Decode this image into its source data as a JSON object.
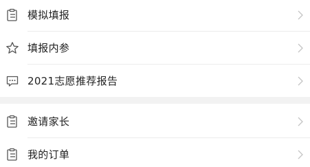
{
  "group1": [
    {
      "label": "模拟填报",
      "icon": "clipboard-icon"
    },
    {
      "label": "填报内参",
      "icon": "star-icon"
    },
    {
      "label": "2021志愿推荐报告",
      "icon": "message-icon"
    }
  ],
  "group2": [
    {
      "label": "邀请家长",
      "icon": "clipboard-icon"
    },
    {
      "label": "我的订单",
      "icon": "clipboard-icon"
    }
  ],
  "colors": {
    "text": "#222222",
    "icon": "#555555",
    "chevron": "#c4c4c4",
    "separator": "#f2f2f2"
  }
}
